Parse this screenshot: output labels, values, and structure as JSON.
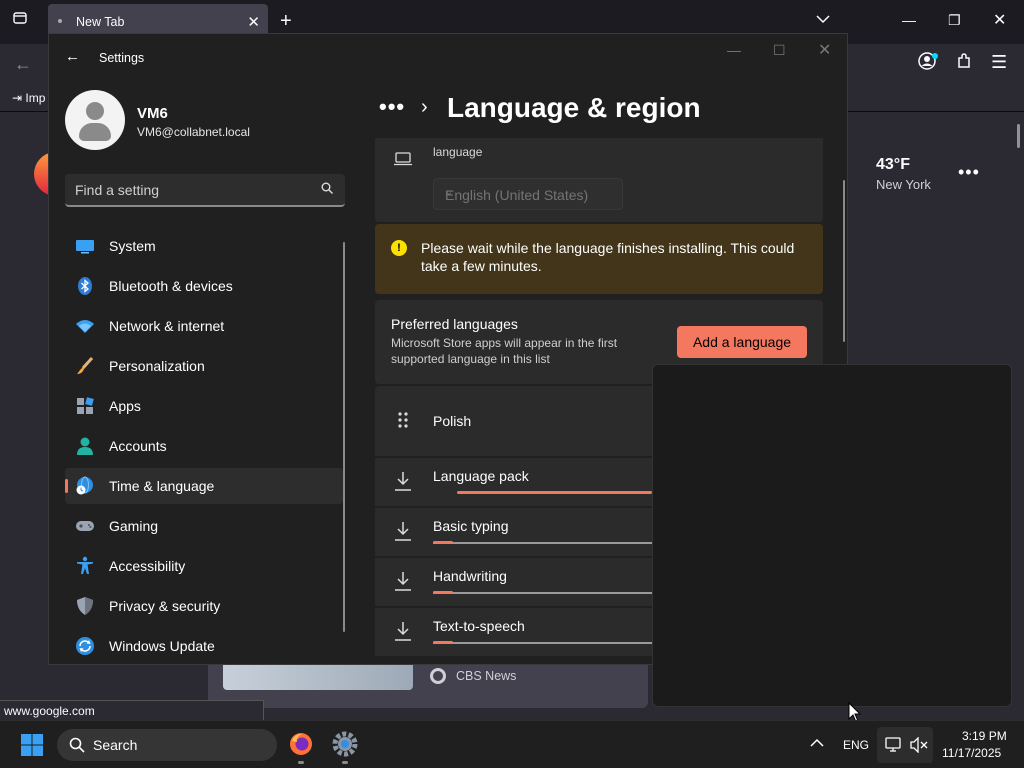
{
  "browser": {
    "tab_title": "New Tab",
    "bookmark_label": "Imp",
    "status_url": "www.google.com",
    "weather": {
      "temp": "43°F",
      "city": "New York"
    },
    "story_source": "CBS News"
  },
  "settings": {
    "window_title": "Settings",
    "user": {
      "name": "VM6",
      "email": "VM6@collabnet.local"
    },
    "search_placeholder": "Find a setting",
    "nav": [
      {
        "label": "System",
        "icon": "monitor-icon"
      },
      {
        "label": "Bluetooth & devices",
        "icon": "bluetooth-icon"
      },
      {
        "label": "Network & internet",
        "icon": "wifi-icon"
      },
      {
        "label": "Personalization",
        "icon": "brush-icon"
      },
      {
        "label": "Apps",
        "icon": "apps-icon"
      },
      {
        "label": "Accounts",
        "icon": "person-icon"
      },
      {
        "label": "Time & language",
        "icon": "globe-clock-icon",
        "active": true
      },
      {
        "label": "Gaming",
        "icon": "gamepad-icon"
      },
      {
        "label": "Accessibility",
        "icon": "accessibility-icon"
      },
      {
        "label": "Privacy & security",
        "icon": "shield-icon"
      },
      {
        "label": "Windows Update",
        "icon": "update-icon"
      }
    ],
    "breadcrumb_more": "•••",
    "page_title": "Language & region",
    "display_language": {
      "description_tail": "language",
      "selected": "English (United States)"
    },
    "warning": "Please wait while the language finishes installing. This could take a few minutes.",
    "preferred": {
      "title": "Preferred languages",
      "description": "Microsoft Store apps will appear in the first supported language in this list",
      "add_button": "Add a language"
    },
    "language": "Polish",
    "downloads": [
      {
        "label": "Language pack",
        "progress": 0.5,
        "indeterminate": true
      },
      {
        "label": "Basic typing",
        "progress": 0.05
      },
      {
        "label": "Handwriting",
        "progress": 0.05
      },
      {
        "label": "Text-to-speech",
        "progress": 0.05
      }
    ]
  },
  "taskbar": {
    "search_label": "Search",
    "lang": "ENG",
    "time": "3:19 PM",
    "date": "11/17/2025"
  },
  "colors": {
    "accent": "#f4775f",
    "warning_bg": "#433519",
    "warning_icon": "#fce100"
  }
}
